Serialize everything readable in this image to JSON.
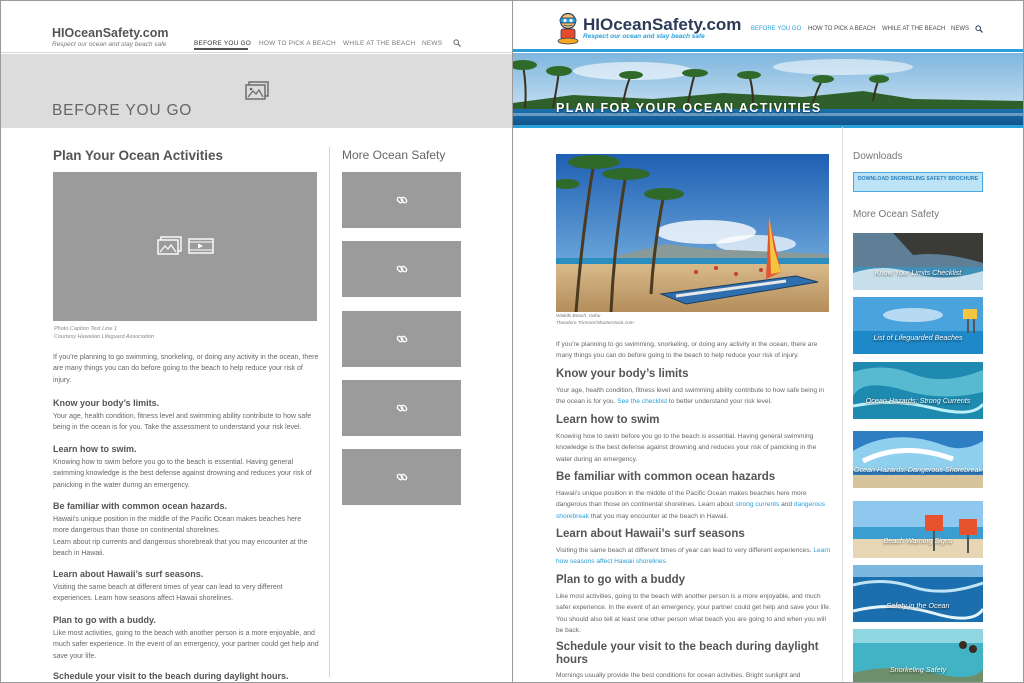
{
  "wireframe": {
    "logo": "HIOceanSafety.com",
    "tagline": "Respect our ocean and stay beach safe",
    "nav": [
      "BEFORE YOU GO",
      "HOW TO PICK A BEACH",
      "WHILE AT THE BEACH",
      "NEWS"
    ],
    "hero_title": "BEFORE YOU GO",
    "main_title": "Plan Your Ocean Activities",
    "caption_line1": "Photo Caption Text Line 1",
    "caption_line2": "Courtesy Hawaiian Lifeguard Association",
    "intro": "If you’re planning to go swimming, snorkeling, or doing any activity in the ocean, there are many things you can do before going to the beach to help reduce your risk of injury.",
    "s1_title": "Know your body’s limits.",
    "s1_body": "Your age, health condition, fitness level and swimming ability contribute to how safe being in the ocean is for you. Take the assessment to understand your risk level.",
    "s2_title": "Learn how to swim.",
    "s2_body": "Knowing how to swim before you go to the beach is essential. Having general swimming knowledge is the best defense against drowning and reduces your risk of panicking in the water during an emergency.",
    "s3_title": "Be familiar with common ocean hazards.",
    "s3_body1": "Hawaii’s unique position in the middle of the Pacific Ocean makes beaches here more dangerous than those on continental shorelines.",
    "s3_body2": "Learn about rip currents and dangerous shorebreak that you may encounter at the beach in Hawaii.",
    "s4_title": "Learn about Hawaii’s surf seasons.",
    "s4_body": "Visiting the same beach at different times of year can lead to very different experiences. Learn how seasons affect Hawaii shorelines.",
    "s5_title": "Plan to go with a buddy.",
    "s5_body": "Like most activities, going to the beach with another person is a more enjoyable, and much safer experience. In the event of an emergency, your partner could get help and save your life.",
    "s6_title": "Schedule your visit to the beach during daylight hours.",
    "side_title": "More Ocean Safety"
  },
  "design": {
    "logo": "HIOceanSafety.com",
    "tagline": "Respect our ocean and stay beach safe",
    "nav": [
      "BEFORE YOU GO",
      "HOW TO PICK A BEACH",
      "WHILE AT THE BEACH",
      "NEWS"
    ],
    "hero_title": "PLAN FOR YOUR OCEAN ACTIVITIES",
    "caption_line1": "Waikiki Beach, Oahu",
    "caption_line2": "Theodore Trimmer/Shutterstock.com",
    "intro": "If you’re planning to go swimming, snorkeling, or doing any activity in the ocean, there are many things you can do before going to the beach to help reduce your risk of injury.",
    "s1_title": "Know your body’s limits",
    "s1_body_a": "Your age, health condition, fitness level and swimming ability contribute to how safe being in the ocean is for you. ",
    "s1_link": "See the checklist",
    "s1_body_b": " to better understand your risk level.",
    "s2_title": "Learn how to swim",
    "s2_body": "Knowing how to swim before you go to the beach is essential. Having general swimming knowledge is the best defense against drowning and reduces your risk of panicking in the water during an emergency.",
    "s3_title": "Be familiar with common ocean hazards",
    "s3_body_a": "Hawaii’s unique position in the middle of the Pacific Ocean makes beaches here more dangerous than those on continental shorelines. Learn about ",
    "s3_link1": "strong currents",
    "s3_body_b": " and ",
    "s3_link2": "dangerous shorebreak",
    "s3_body_c": " that you may encounter at the beach in Hawaii.",
    "s4_title": "Learn about Hawaii’s surf seasons",
    "s4_body": "Visiting the same beach at different times of year can lead to very different experiences.",
    "s4_link": "Learn how seasons affect Hawaii shorelines.",
    "s5_title": "Plan to go with a buddy",
    "s5_body": "Like most activities, going to the beach with another person is a more enjoyable, and much safer experience. In the event of an emergency, your partner could get help and save your life. You should also tell at least one other person what beach you are going to and when you will be back.",
    "s6_title": "Schedule your visit to the beach during daylight hours",
    "s6_body": "Mornings usually provide the best conditions for ocean activities. Bright sunlight and",
    "downloads_title": "Downloads",
    "download_button": "DOWNLOAD SNORKELING SAFETY BROCHURE",
    "side_title": "More Ocean Safety",
    "tiles": [
      "Know Your Limits Checklist",
      "List of Lifeguarded Beaches",
      "Ocean Hazards: Strong Currents",
      "Ocean Hazards: Dangerous Shorebreak",
      "Beach Warning Signs",
      "Safety in the Ocean",
      "Snorkeling Safety"
    ]
  },
  "colors": {
    "accent": "#2a9fd8",
    "brand_text": "#2b3b58",
    "wireframe_gray": "#9b9b9b"
  }
}
